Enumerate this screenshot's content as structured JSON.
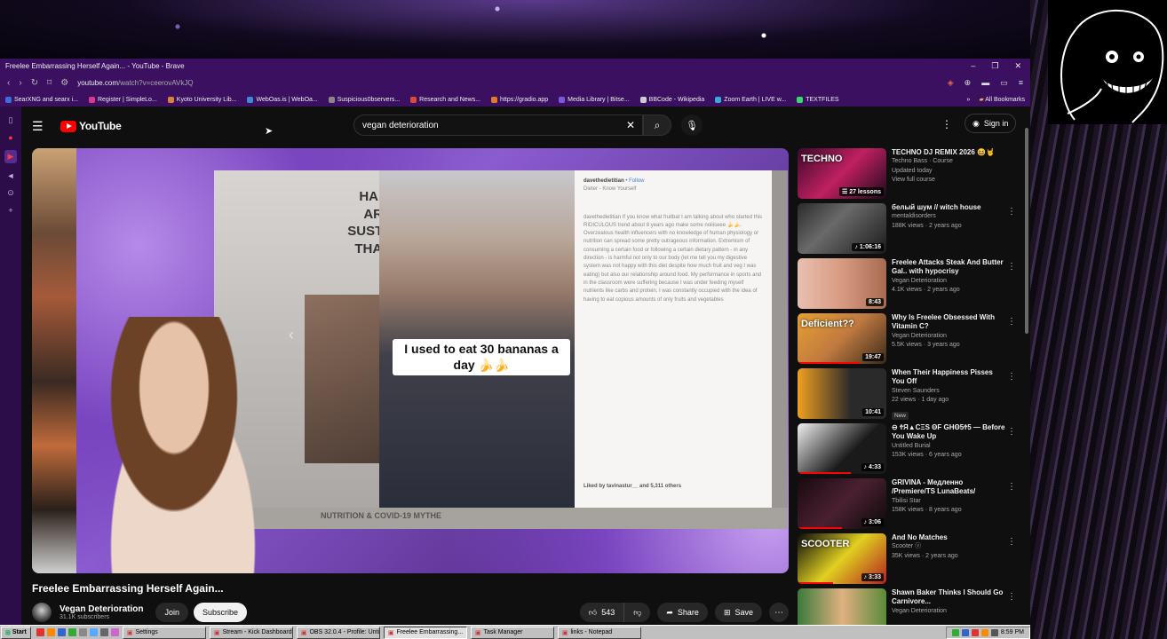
{
  "window": {
    "title": "Freelee Embarrassing Herself Again... - YouTube - Brave"
  },
  "browser": {
    "url_main": "youtube.com",
    "url_path": "/watch?v=ceerovAVkJQ",
    "bookmarks": [
      {
        "label": "SearXNG and searx i...",
        "color": "#3a6fd8"
      },
      {
        "label": "Register | SimpleLo...",
        "color": "#d83a8a"
      },
      {
        "label": "Kyoto University Lib...",
        "color": "#d8823a"
      },
      {
        "label": "WebOas.is | WebOa...",
        "color": "#3a8ad8"
      },
      {
        "label": "Suspicious0bservers...",
        "color": "#888888"
      },
      {
        "label": "Research and News...",
        "color": "#d84a3a"
      },
      {
        "label": "https://gradio.app",
        "color": "#e07a2a"
      },
      {
        "label": "Media Library | Bitse...",
        "color": "#7a5ad8"
      },
      {
        "label": "BBCode - Wikipedia",
        "color": "#cccccc"
      },
      {
        "label": "Zoom Earth | LIVE w...",
        "color": "#3aa8d8"
      },
      {
        "label": "TEXTFILES",
        "color": "#3ad86a"
      }
    ],
    "all_bookmarks": "All Bookmarks"
  },
  "youtube": {
    "logo": "YouTube",
    "search_value": "vegan deterioration",
    "sign_in": "Sign in",
    "video": {
      "slide_headline": "HABI ARE SUSTA THAN",
      "caption": "I used to eat 30 bananas a day 🍌🍌",
      "ig_user": "davethedietitian",
      "ig_follow": "• Follow",
      "ig_sub": "Dieter - Know Yourself",
      "ig_text": "davethedietitian If you know what fruitbat I am talking about who started this RIDICULOUS trend about 8 years ago make some noiiiseee 🍌🍌. Overzealous health influencers with no knowledge of human physiology or nutrition can spread some pretty outrageous information. Extremism of consuming a certain food or following a certain dietary pattern - in any direction - is harmful not only to our body (let me tell you my digestive system was not happy with this diet despite how much fruit and veg I was eating) but also our relationship around food. My performance in sports and in the classroom were suffering because I was under feeding myself nutrients like carbs and protein. I was constantly occupied with the idea of having to eat copious amounts of only fruits and vegetables",
      "ig_likes": "Liked by tavinastur__ and 5,311 others",
      "footer": "NUTRITION & COVID-19 MYTHE"
    },
    "title": "Freelee Embarrassing Herself Again...",
    "channel": {
      "name": "Vegan Deterioration",
      "subs": "31.1K subscribers"
    },
    "join": "Join",
    "subscribe": "Subscribe",
    "likes": "543",
    "share": "Share",
    "save": "Save",
    "recommendations": [
      {
        "title": "TECHNO DJ REMIX 2026 😆🤘",
        "line1": "Techno Bass · Course",
        "line2": "Updated today",
        "line3": "View full course",
        "badge": "☰ 27 lessons",
        "bg": "linear-gradient(135deg,#3a0a2a,#c02060 50%,#1a0a1a)",
        "thumb_text": "TECHNO",
        "progress": 0
      },
      {
        "title": "белый шум // witch house",
        "line1": "mentaldisorders",
        "line2": "188K views · 2 years ago",
        "badge": "♪ 1:06:16",
        "bg": "linear-gradient(135deg,#2a2a2a,#6a6a6a 40%,#1a1a1a)",
        "progress": 0
      },
      {
        "title": "Freelee Attacks Steak And Butter Gal.. with hypocrisy",
        "line1": "Vegan Deterioration",
        "line2": "4.1K views · 2 years ago",
        "badge": "8:43",
        "bg": "linear-gradient(90deg,#e8c0b0,#d89a80 50%,#a86a50)",
        "progress": 0
      },
      {
        "title": "Why Is Freelee Obsessed With Vitamin C?",
        "line1": "Vegan Deterioration",
        "line2": "5.5K views · 3 years ago",
        "badge": "19:47",
        "bg": "linear-gradient(135deg,#e8a030,#c07a40 50%,#3a2a1a)",
        "thumb_text": "Deficient??",
        "progress": 0.7
      },
      {
        "title": "When Their Happiness Pisses You Off",
        "line1": "Steven Saunders",
        "line2": "22 views · 1 day ago",
        "new": "New",
        "badge": "10:41",
        "bg": "linear-gradient(90deg,#f0a020,#2a2a2a 60%)",
        "progress": 0
      },
      {
        "title": "⊖ ϮЯ▲CΞS ΘF GHΘ5Ϯ5 — Before You Wake Up",
        "line1": "Untitled Burial",
        "line2": "153K views · 6 years ago",
        "badge": "♪ 4:33",
        "bg": "linear-gradient(135deg,#f0f0f0,#1a1a1a 60%)",
        "progress": 0.6
      },
      {
        "title": "GRIVINA - Медленно /Premiere/TS LunaBeats/",
        "line1": "Tbilisi Star",
        "line2": "158K views · 8 years ago",
        "badge": "♪ 3:06",
        "bg": "linear-gradient(135deg,#1a0a10,#4a2030 50%,#0a0a0a)",
        "progress": 0.5
      },
      {
        "title": "And No Matches",
        "line1": "Scooter ⓥ",
        "line2": "35K views · 2 years ago",
        "badge": "♪ 3:33",
        "bg": "linear-gradient(135deg,#0a0a0a,#e0d020 50%,#b02020)",
        "thumb_text": "SCOOTER",
        "progress": 0.4
      },
      {
        "title": "Shawn Baker Thinks I Should Go Carnivore...",
        "line1": "Vegan Deterioration",
        "line2": "",
        "badge": "",
        "bg": "linear-gradient(90deg,#3a7a3a,#e0b080 50%,#5a8a3a)",
        "progress": 0.3
      }
    ]
  },
  "taskbar": {
    "start": "Start",
    "tasks": [
      {
        "label": "Settings",
        "active": false
      },
      {
        "label": "Stream - Kick Dashboard ...",
        "active": false
      },
      {
        "label": "OBS 32.0.4 - Profile: Untitl...",
        "active": false
      },
      {
        "label": "Freelee Embarrassing...",
        "active": true
      },
      {
        "label": "Task Manager",
        "active": false
      },
      {
        "label": "links - Notepad",
        "active": false
      }
    ],
    "clock": "8:59 PM"
  }
}
